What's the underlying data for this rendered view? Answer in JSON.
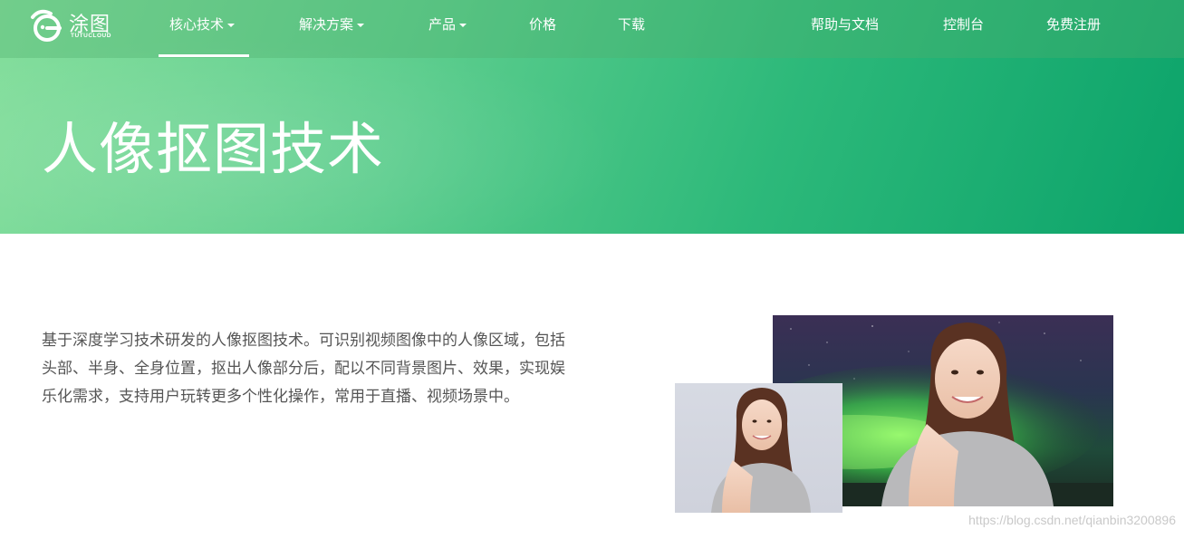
{
  "brand": {
    "name": "涂图",
    "subtitle": "TUTUCLOUD"
  },
  "nav": {
    "left": [
      {
        "label": "核心技术",
        "dropdown": true,
        "active": true
      },
      {
        "label": "解决方案",
        "dropdown": true
      },
      {
        "label": "产品",
        "dropdown": true
      },
      {
        "label": "价格",
        "dropdown": false
      },
      {
        "label": "下载",
        "dropdown": false
      }
    ],
    "right": [
      {
        "label": "帮助与文档"
      },
      {
        "label": "控制台"
      },
      {
        "label": "免费注册"
      }
    ]
  },
  "hero": {
    "title": "人像抠图技术"
  },
  "content": {
    "description": "基于深度学习技术研发的人像抠图技术。可识别视频图像中的人像区域，包括头部、半身、全身位置，抠出人像部分后，配以不同背景图片、效果，实现娱乐化需求，支持用户玩转更多个性化操作，常用于直播、视频场景中。"
  },
  "watermark": "https://blog.csdn.net/qianbin3200896",
  "colors": {
    "brand_green_light": "#84de9c",
    "brand_green_dark": "#0ba36a",
    "text_body": "#555555"
  },
  "icons": {
    "logo": "tutu-logo-icon",
    "dropdown": "caret-down-icon"
  }
}
